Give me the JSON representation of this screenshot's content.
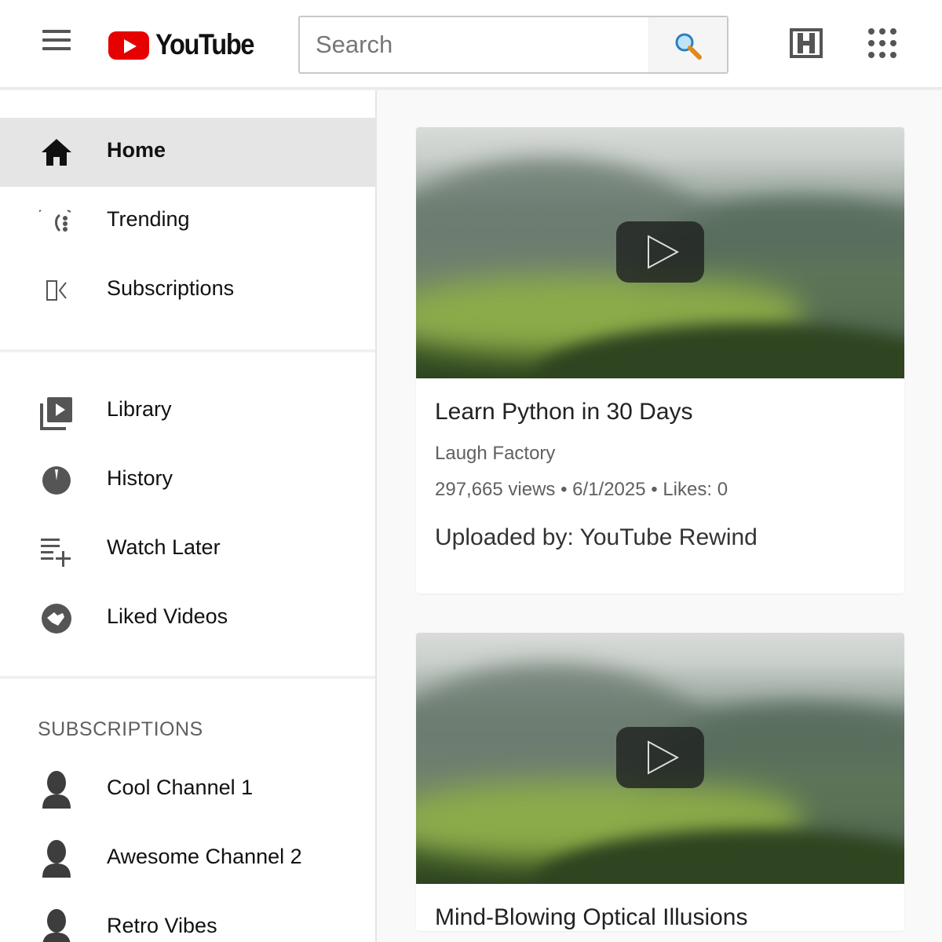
{
  "header": {
    "logo_text": "YouTube",
    "search": {
      "placeholder": "Search",
      "value": ""
    }
  },
  "sidebar": {
    "primary": [
      {
        "label": "Home",
        "icon": "home-icon",
        "active": true
      },
      {
        "label": "Trending",
        "icon": "trending-icon",
        "active": false
      },
      {
        "label": "Subscriptions",
        "icon": "subscriptions-icon",
        "active": false
      }
    ],
    "secondary": [
      {
        "label": "Library",
        "icon": "library-icon"
      },
      {
        "label": "History",
        "icon": "history-icon"
      },
      {
        "label": "Watch Later",
        "icon": "watch-later-icon"
      },
      {
        "label": "Liked Videos",
        "icon": "liked-videos-icon"
      }
    ],
    "subscriptions_title": "SUBSCRIPTIONS",
    "subscriptions": [
      {
        "name": "Cool Channel 1"
      },
      {
        "name": "Awesome Channel 2"
      },
      {
        "name": "Retro Vibes"
      }
    ]
  },
  "videos": [
    {
      "title": "Learn Python in 30 Days",
      "channel": "Laugh Factory",
      "meta": "297,665 views • 6/1/2025 • Likes: 0",
      "uploader": "Uploaded by: YouTube Rewind"
    },
    {
      "title": "Mind-Blowing Optical Illusions"
    }
  ],
  "colors": {
    "brand_red": "#e60000",
    "active_nav_bg": "#e5e5e5",
    "icon_gray": "#555555"
  }
}
